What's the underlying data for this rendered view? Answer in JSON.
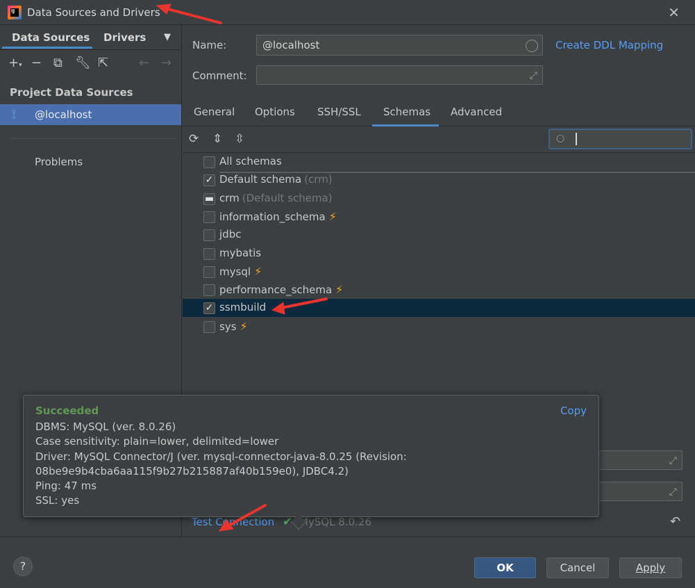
{
  "window": {
    "title": "Data Sources and Drivers",
    "app_icon_text": "IJ"
  },
  "left": {
    "tabs": [
      "Data Sources",
      "Drivers"
    ],
    "section_label": "Project Data Sources",
    "selected_source": "@localhost",
    "problems_label": "Problems"
  },
  "form": {
    "name_label": "Name:",
    "name_value": "@localhost",
    "comment_label": "Comment:",
    "comment_value": "",
    "ddl_link": "Create DDL Mapping"
  },
  "tabs": [
    "General",
    "Options",
    "SSH/SSL",
    "Schemas",
    "Advanced"
  ],
  "active_tab": "Schemas",
  "schemas": [
    {
      "name": "All schemas",
      "state": "unchecked",
      "hint": "",
      "bolt": false
    },
    {
      "name": "Default schema",
      "state": "checked",
      "hint": "(crm)",
      "bolt": false
    },
    {
      "name": "crm",
      "state": "indeterminate",
      "hint": "(Default schema)",
      "bolt": false
    },
    {
      "name": "information_schema",
      "state": "unchecked",
      "hint": "",
      "bolt": true
    },
    {
      "name": "jdbc",
      "state": "unchecked",
      "hint": "",
      "bolt": false
    },
    {
      "name": "mybatis",
      "state": "unchecked",
      "hint": "",
      "bolt": false
    },
    {
      "name": "mysql",
      "state": "unchecked",
      "hint": "",
      "bolt": true
    },
    {
      "name": "performance_schema",
      "state": "unchecked",
      "hint": "",
      "bolt": true
    },
    {
      "name": "ssmbuild",
      "state": "checked",
      "hint": "",
      "bolt": false,
      "selected": true
    },
    {
      "name": "sys",
      "state": "unchecked",
      "hint": "",
      "bolt": true
    }
  ],
  "popup": {
    "status": "Succeeded",
    "copy_label": "Copy",
    "lines": [
      "DBMS: MySQL (ver. 8.0.26)",
      "Case sensitivity: plain=lower, delimited=lower",
      "Driver: MySQL Connector/J (ver. mysql-connector-java-8.0.25 (Revision:",
      "08be9e9b4cba6aa115f9b27b215887af40b159e0), JDBC4.2)",
      "Ping: 47 ms",
      "SSL: yes"
    ]
  },
  "bottom": {
    "test_connection": "Test Connection",
    "version": "MySQL 8.0.26"
  },
  "footer": {
    "help": "?",
    "ok": "OK",
    "cancel": "Cancel",
    "apply": "Apply"
  },
  "colors": {
    "accent": "#4a88c7",
    "link": "#589df6",
    "success": "#629755",
    "annotation": "#e8342c"
  }
}
